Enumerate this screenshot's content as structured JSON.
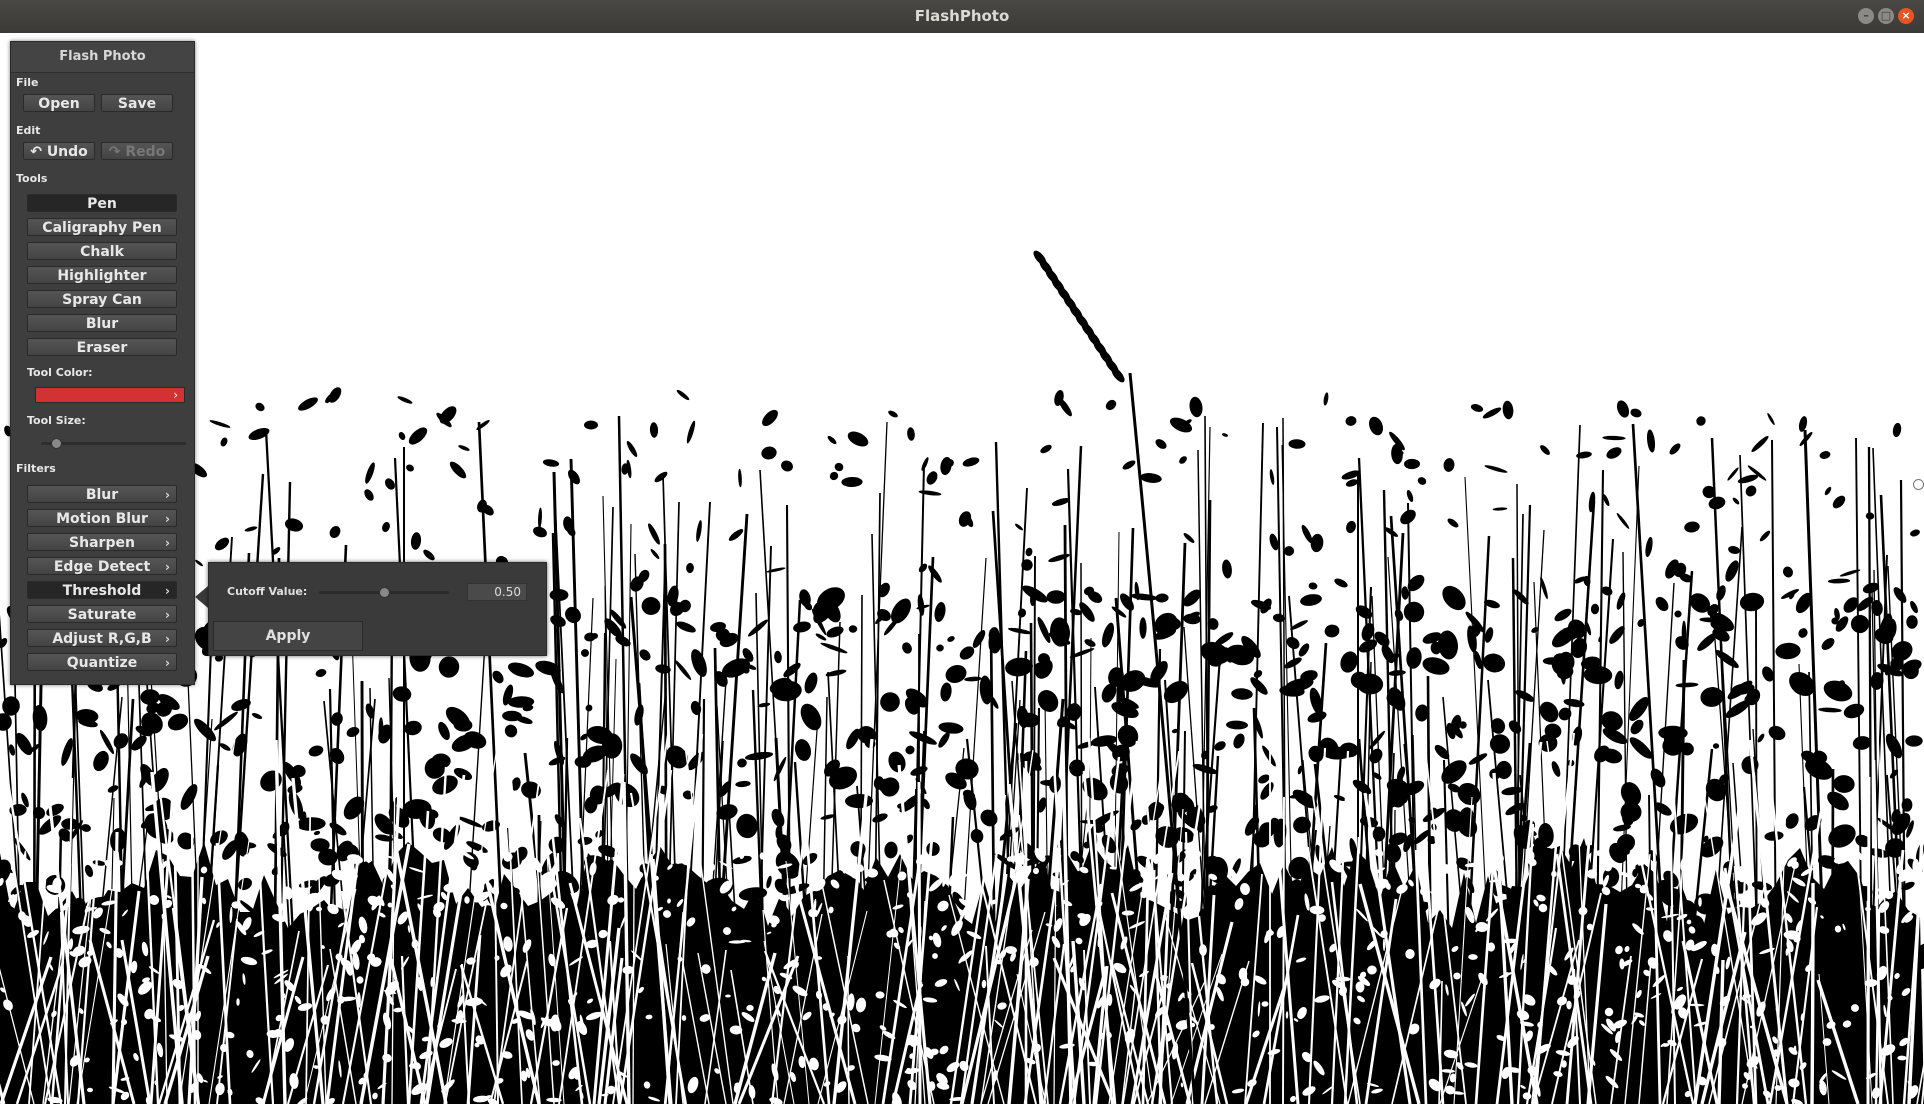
{
  "window": {
    "title": "FlashPhoto",
    "controls": [
      "minimize-icon",
      "maximize-icon",
      "close-icon"
    ]
  },
  "panel": {
    "title": "Flash Photo",
    "file": {
      "label": "File",
      "open": "Open",
      "save": "Save"
    },
    "edit": {
      "label": "Edit",
      "undo": "Undo",
      "redo": "Redo",
      "undo_icon": "↶",
      "redo_icon": "↷"
    },
    "tools": {
      "label": "Tools",
      "items": [
        "Pen",
        "Caligraphy Pen",
        "Chalk",
        "Highlighter",
        "Spray Can",
        "Blur",
        "Eraser"
      ],
      "selected": "Pen"
    },
    "tool_color": {
      "label": "Tool Color:",
      "color": "#d33232"
    },
    "tool_size": {
      "label": "Tool Size:",
      "level": 0.1
    },
    "filters": {
      "label": "Filters",
      "items": [
        "Blur",
        "Motion Blur",
        "Sharpen",
        "Edge Detect",
        "Threshold",
        "Saturate",
        "Adjust R,G,B",
        "Quantize"
      ],
      "selected": "Threshold"
    }
  },
  "threshold_popup": {
    "label": "Cutoff Value:",
    "value": "0.50",
    "slider_level": 0.5,
    "apply": "Apply"
  },
  "colors": {
    "panel_bg": "#3e3e3e",
    "titlebar": "#3b3a37",
    "close": "#e95420"
  }
}
